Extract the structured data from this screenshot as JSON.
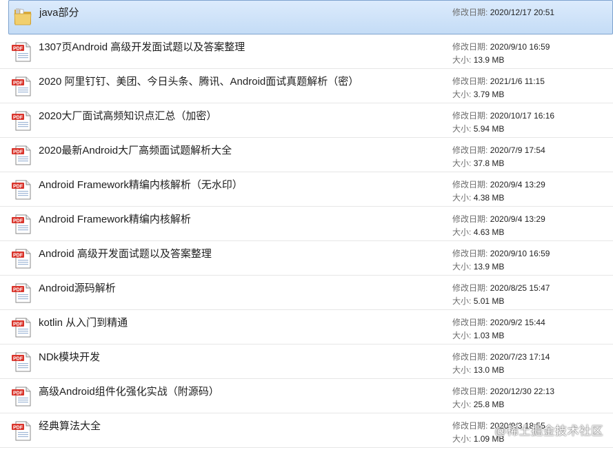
{
  "folder": {
    "name": "java部分",
    "date_label": "修改日期:",
    "date": "2020/12/17 20:51",
    "icon": "folder-icon"
  },
  "files": [
    {
      "name": "1307页Android 高级开发面试题以及答案整理",
      "date_label": "修改日期:",
      "date": "2020/9/10 16:59",
      "size_label": "大小:",
      "size": "13.9 MB"
    },
    {
      "name": "2020 阿里钉钉、美团、今日头条、腾讯、Android面试真题解析（密）",
      "date_label": "修改日期:",
      "date": "2021/1/6 11:15",
      "size_label": "大小:",
      "size": "3.79 MB"
    },
    {
      "name": "2020大厂面试高频知识点汇总（加密）",
      "date_label": "修改日期:",
      "date": "2020/10/17 16:16",
      "size_label": "大小:",
      "size": "5.94 MB"
    },
    {
      "name": "2020最新Android大厂高频面试题解析大全",
      "date_label": "修改日期:",
      "date": "2020/7/9 17:54",
      "size_label": "大小:",
      "size": "37.8 MB"
    },
    {
      "name": "Android Framework精编内核解析（无水印）",
      "date_label": "修改日期:",
      "date": "2020/9/4 13:29",
      "size_label": "大小:",
      "size": "4.38 MB"
    },
    {
      "name": "Android Framework精编内核解析",
      "date_label": "修改日期:",
      "date": "2020/9/4 13:29",
      "size_label": "大小:",
      "size": "4.63 MB"
    },
    {
      "name": "Android 高级开发面试题以及答案整理",
      "date_label": "修改日期:",
      "date": "2020/9/10 16:59",
      "size_label": "大小:",
      "size": "13.9 MB"
    },
    {
      "name": "Android源码解析",
      "date_label": "修改日期:",
      "date": "2020/8/25 15:47",
      "size_label": "大小:",
      "size": "5.01 MB"
    },
    {
      "name": "kotlin 从入门到精通",
      "date_label": "修改日期:",
      "date": "2020/9/2 15:44",
      "size_label": "大小:",
      "size": "1.03 MB"
    },
    {
      "name": "NDk模块开发",
      "date_label": "修改日期:",
      "date": "2020/7/23 17:14",
      "size_label": "大小:",
      "size": "13.0 MB"
    },
    {
      "name": "高级Android组件化强化实战（附源码）",
      "date_label": "修改日期:",
      "date": "2020/12/30 22:13",
      "size_label": "大小:",
      "size": "25.8 MB"
    },
    {
      "name": "经典算法大全",
      "date_label": "修改日期:",
      "date": "2020/9/3 18:55",
      "size_label": "大小:",
      "size": "1.09 MB"
    }
  ],
  "file_icon": "pdf-file-icon",
  "pdf_badge": "PDF",
  "colors": {
    "selection": "#c4dcf6",
    "pdf_badge": "#d9342b",
    "folder": "#e9c46a"
  },
  "watermark": "@稀土掘金技术社区"
}
